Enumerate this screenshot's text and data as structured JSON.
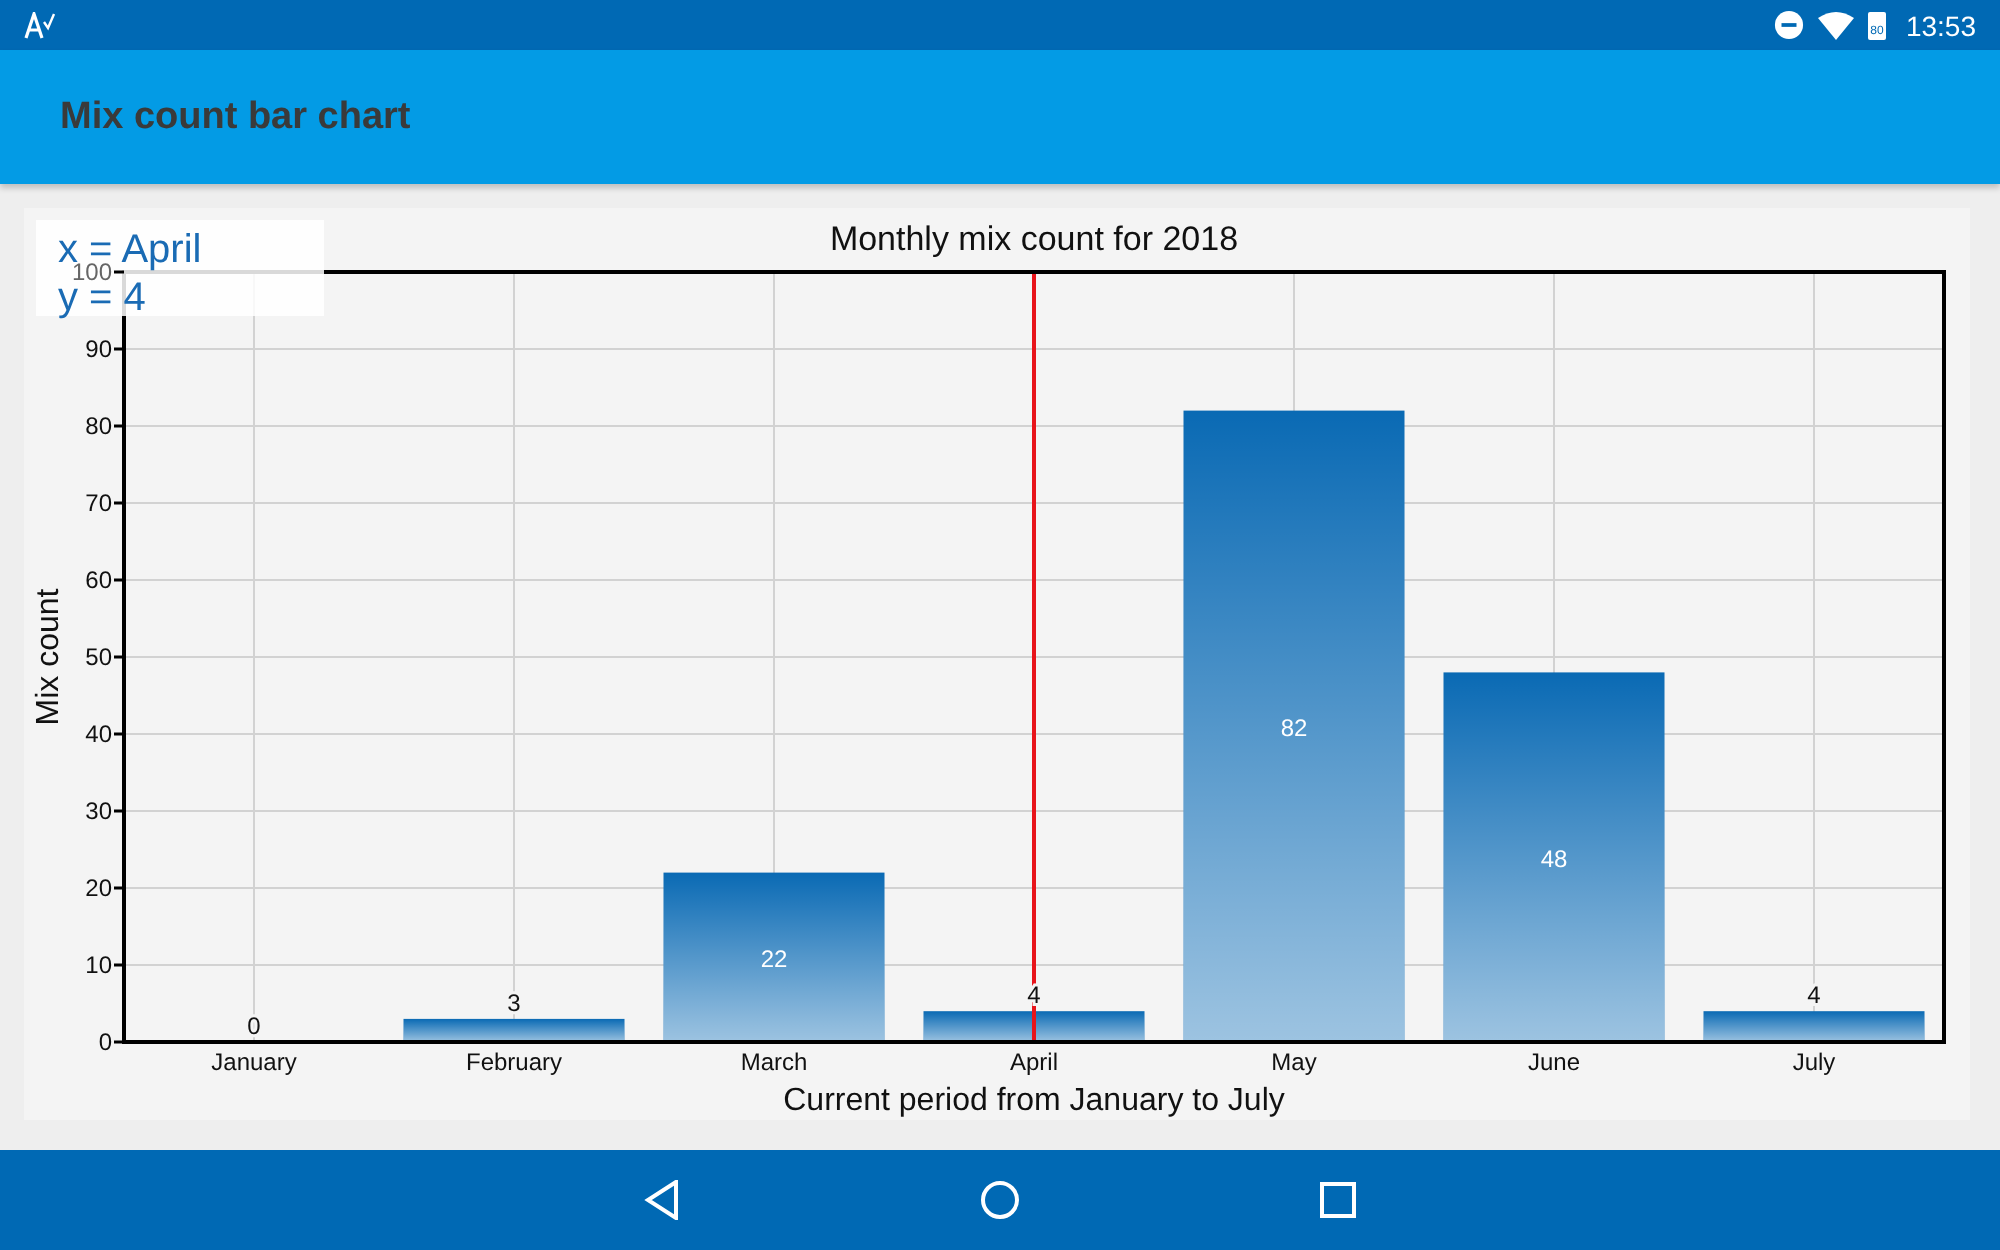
{
  "status_bar": {
    "battery": "80",
    "time": "13:53"
  },
  "app_bar": {
    "title": "Mix count bar chart"
  },
  "chart": {
    "tooltip": [
      "x = April",
      "y = 4"
    ],
    "chart_data": {
      "type": "bar",
      "title": "Monthly mix count for 2018",
      "xlabel": "Current period from January to July",
      "ylabel": "Mix count",
      "categories": [
        "January",
        "February",
        "March",
        "April",
        "May",
        "June",
        "July"
      ],
      "series": [
        {
          "color": "#0a6ab4",
          "values": [
            0,
            3,
            22,
            4,
            82,
            48,
            4
          ]
        }
      ],
      "ylim": [
        0,
        100
      ],
      "yticks": [
        0,
        10,
        20,
        30,
        40,
        50,
        60,
        70,
        80,
        90,
        100
      ],
      "data_labels": true,
      "grid": true,
      "ref_lines": [
        {
          "axis": "x",
          "value": "April",
          "color": "#e8141b"
        }
      ]
    }
  }
}
